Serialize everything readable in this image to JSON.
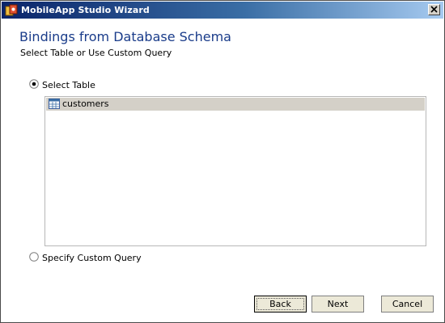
{
  "window": {
    "title": "MobileApp Studio Wizard"
  },
  "header": {
    "heading": "Bindings from Database Schema",
    "subheading": "Select Table or Use Custom Query"
  },
  "options": {
    "select_table": {
      "label": "Select Table",
      "checked": true
    },
    "custom_query": {
      "label": "Specify Custom Query",
      "checked": false
    }
  },
  "tables": [
    {
      "name": "customers",
      "selected": true
    }
  ],
  "buttons": {
    "back": "Back",
    "next": "Next",
    "cancel": "Cancel"
  },
  "colors": {
    "titlebar_start": "#0a246a",
    "titlebar_end": "#a6caf0",
    "heading": "#1a3c8a",
    "selection": "#d4d0c8"
  }
}
